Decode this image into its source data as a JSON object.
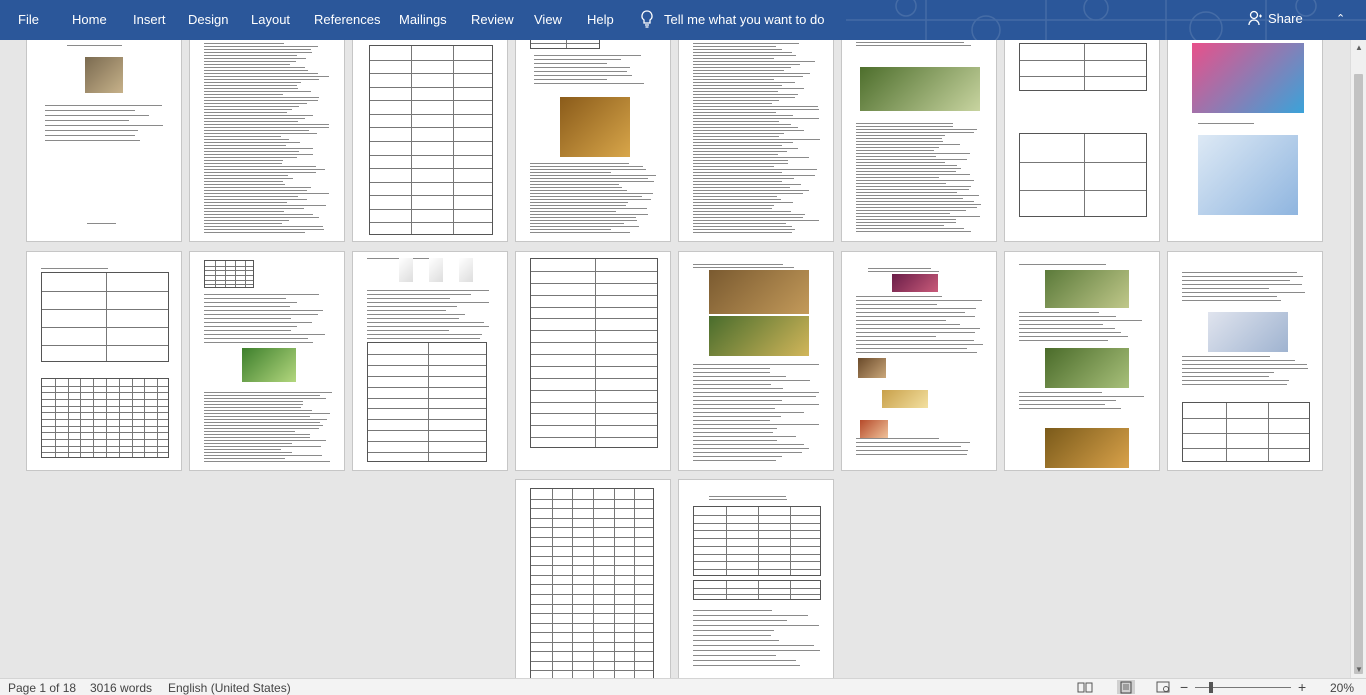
{
  "ribbon": {
    "tabs": [
      "File",
      "Home",
      "Insert",
      "Design",
      "Layout",
      "References",
      "Mailings",
      "Review",
      "View",
      "Help"
    ],
    "tell_me": "Tell me what you want to do",
    "share": "Share",
    "color": "#2b579a"
  },
  "status": {
    "page": "Page 1 of 18",
    "words": "3016 words",
    "language": "English (United States)",
    "zoom": "20%",
    "zoom_out": "−",
    "zoom_in": "+"
  },
  "document": {
    "pages_visible": 18
  }
}
